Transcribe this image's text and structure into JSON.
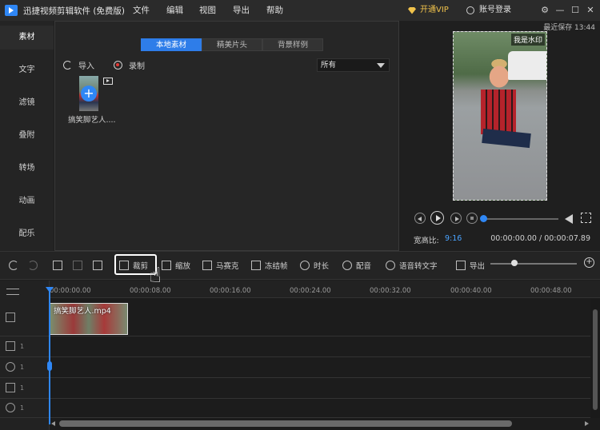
{
  "app": {
    "title": "迅捷视频剪辑软件 (免费版)"
  },
  "menu": [
    "文件",
    "编辑",
    "视图",
    "导出",
    "帮助"
  ],
  "header": {
    "vip_label": "开通VIP",
    "account_label": "账号登录",
    "window_buttons": [
      "⚙",
      "—",
      "☐",
      "✕"
    ]
  },
  "sidebar": {
    "items": [
      "素材",
      "文字",
      "滤镜",
      "叠附",
      "转场",
      "动画",
      "配乐"
    ]
  },
  "media": {
    "tabs": [
      "本地素材",
      "精美片头",
      "背景样例"
    ],
    "import_label": "导入",
    "record_label": "录制",
    "filter_value": "所有",
    "clip_name": "搞笑脚艺人...."
  },
  "preview": {
    "saved_text": "最近保存 13:44",
    "watermark": "我是水印",
    "ratio_label": "宽高比:",
    "ratio_value": "9:16",
    "timecode": "00:00:00.00 / 00:00:07.89"
  },
  "toolbar": {
    "crop": "裁剪",
    "zoom": "缩放",
    "mosaic": "马赛克",
    "freeze": "冻结帧",
    "duration": "时长",
    "dub": "配音",
    "speech_to_text": "语音转文字",
    "export": "导出"
  },
  "timeline": {
    "ticks": [
      "00:00:00.00",
      "00:00:08.00",
      "00:00:16.00",
      "00:00:24.00",
      "00:00:32.00",
      "00:00:40.00",
      "00:00:48.00"
    ],
    "clip_label": "搞笑脚艺人.mp4",
    "track_num": "1"
  },
  "colors": {
    "accent": "#2e7de9",
    "vip": "#f0c24b",
    "background": "#1e1e1e"
  }
}
